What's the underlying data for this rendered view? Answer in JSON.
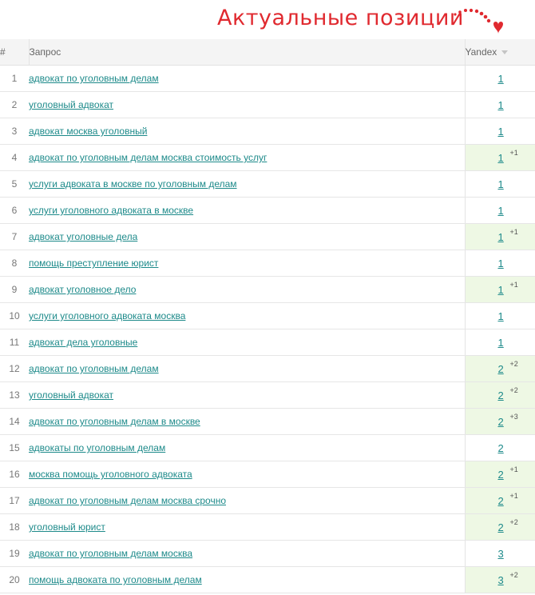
{
  "banner": {
    "title": "Актуальные позиции",
    "title_color": "#e0292f"
  },
  "table": {
    "headers": {
      "num": "#",
      "query": "Запрос",
      "yandex": "Yandex"
    },
    "colors": {
      "link": "#1d8a8a",
      "improved_bg": "#eef8e4"
    },
    "rows": [
      {
        "num": "1",
        "query": "адвокат по уголовным делам",
        "position": "1",
        "delta": ""
      },
      {
        "num": "2",
        "query": "уголовный адвокат",
        "position": "1",
        "delta": ""
      },
      {
        "num": "3",
        "query": "адвокат москва уголовный",
        "position": "1",
        "delta": ""
      },
      {
        "num": "4",
        "query": "адвокат по уголовным делам москва стоимость услуг",
        "position": "1",
        "delta": "+1"
      },
      {
        "num": "5",
        "query": "услуги адвоката в москве по уголовным делам",
        "position": "1",
        "delta": ""
      },
      {
        "num": "6",
        "query": "услуги уголовного адвоката в москве",
        "position": "1",
        "delta": ""
      },
      {
        "num": "7",
        "query": "адвокат уголовные дела",
        "position": "1",
        "delta": "+1"
      },
      {
        "num": "8",
        "query": "помощь преступление юрист",
        "position": "1",
        "delta": ""
      },
      {
        "num": "9",
        "query": "адвокат уголовное дело",
        "position": "1",
        "delta": "+1"
      },
      {
        "num": "10",
        "query": "услуги уголовного адвоката москва",
        "position": "1",
        "delta": ""
      },
      {
        "num": "11",
        "query": "адвокат дела уголовные",
        "position": "1",
        "delta": ""
      },
      {
        "num": "12",
        "query": "адвокат по уголовным делам",
        "position": "2",
        "delta": "+2"
      },
      {
        "num": "13",
        "query": "уголовный адвокат",
        "position": "2",
        "delta": "+2"
      },
      {
        "num": "14",
        "query": "адвокат по уголовным делам в москве",
        "position": "2",
        "delta": "+3"
      },
      {
        "num": "15",
        "query": "адвокаты по уголовным делам",
        "position": "2",
        "delta": ""
      },
      {
        "num": "16",
        "query": "москва помощь уголовного адвоката",
        "position": "2",
        "delta": "+1"
      },
      {
        "num": "17",
        "query": "адвокат по уголовным делам москва срочно",
        "position": "2",
        "delta": "+1"
      },
      {
        "num": "18",
        "query": "уголовный юрист",
        "position": "2",
        "delta": "+2"
      },
      {
        "num": "19",
        "query": "адвокат по уголовным делам москва",
        "position": "3",
        "delta": ""
      },
      {
        "num": "20",
        "query": "помощь адвоката по уголовным делам",
        "position": "3",
        "delta": "+2"
      }
    ]
  }
}
